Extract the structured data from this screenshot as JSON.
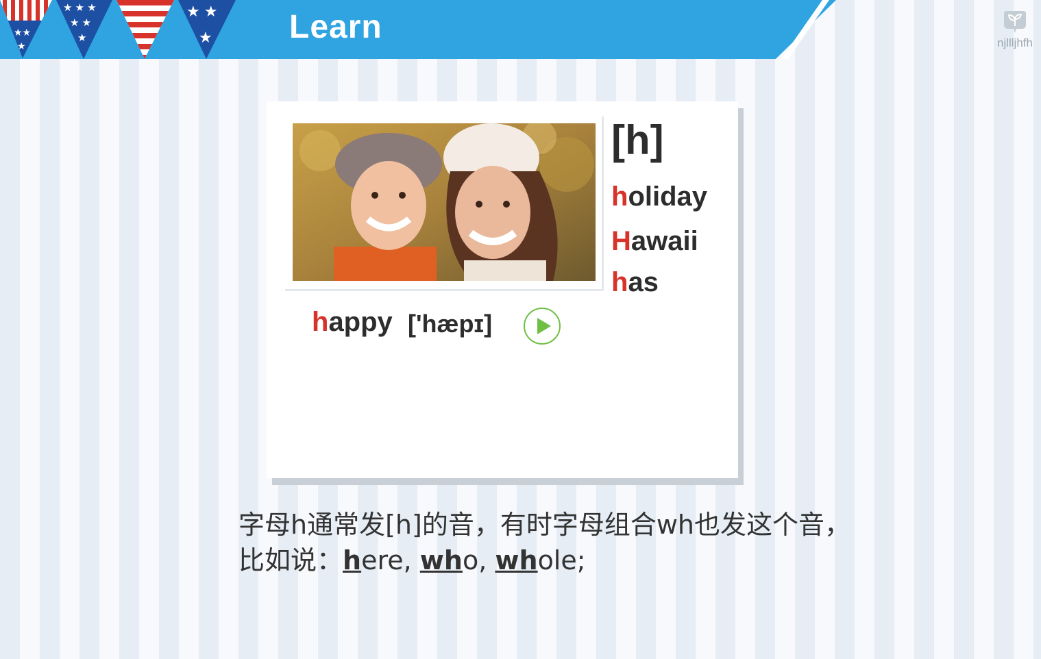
{
  "header": {
    "title": "Learn"
  },
  "watermark": {
    "text": "njllljhfh"
  },
  "lesson": {
    "phonetic": "[h]",
    "words": [
      {
        "initial": "h",
        "rest": "oliday"
      },
      {
        "initial": "H",
        "rest": "awaii"
      },
      {
        "initial": "h",
        "rest": "as"
      }
    ],
    "example": {
      "initial": "h",
      "rest": "appy",
      "ipa": "['hæpɪ]"
    }
  },
  "description": {
    "line1": "字母h通常发[h]的音，有时字母组合wh也发这个音，",
    "line2_prefix": "比如说：",
    "ex1_u": "h",
    "ex1_rest": "ere, ",
    "ex2_u": "wh",
    "ex2_rest": "o, ",
    "ex3_u": "wh",
    "ex3_rest": "ole;"
  },
  "colors": {
    "accent": "#d7332a",
    "header": "#2fa4e0",
    "play": "#6fbf45"
  }
}
